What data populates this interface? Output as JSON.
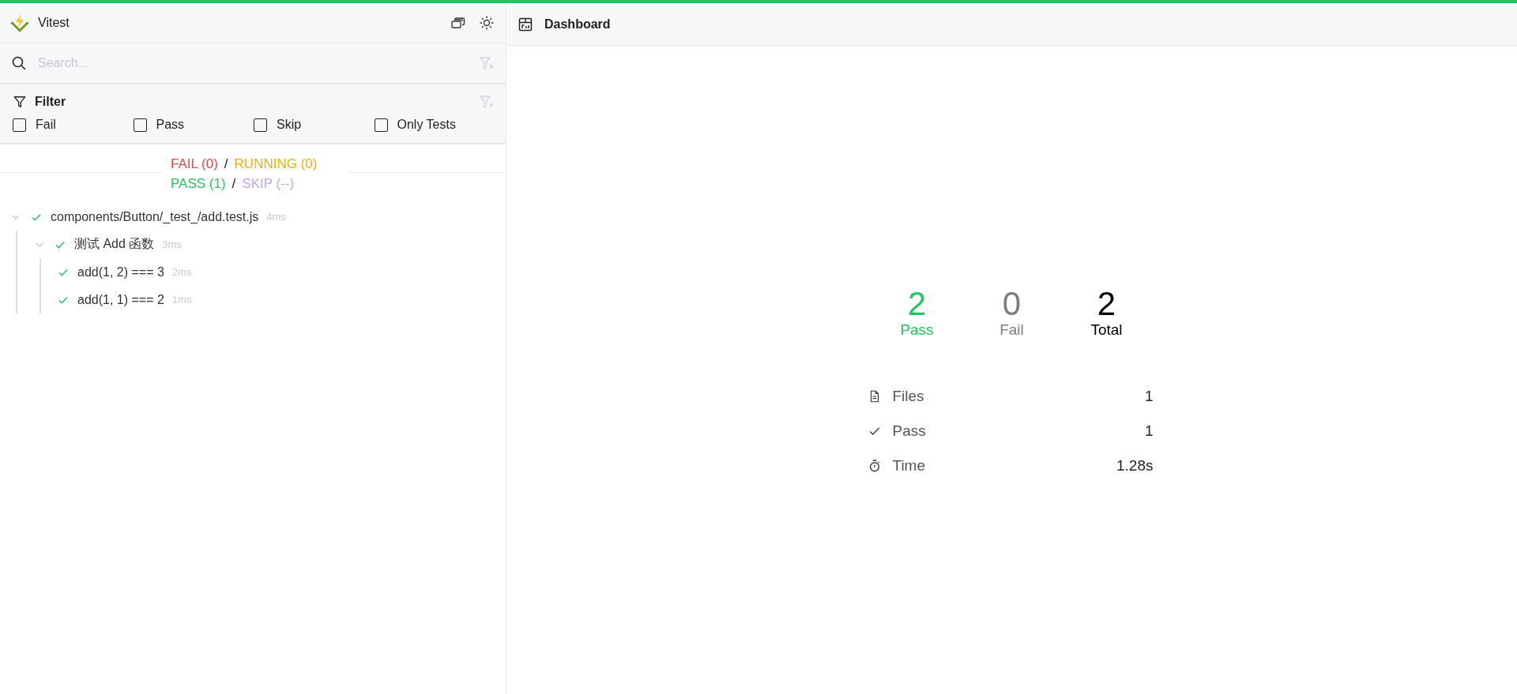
{
  "app": {
    "title": "Vitest"
  },
  "search": {
    "placeholder": "Search..."
  },
  "filter": {
    "title": "Filter",
    "options": [
      {
        "label": "Fail",
        "checked": false
      },
      {
        "label": "Pass",
        "checked": false
      },
      {
        "label": "Skip",
        "checked": false
      },
      {
        "label": "Only Tests",
        "checked": false
      }
    ]
  },
  "summary": [
    {
      "left": {
        "text": "FAIL (0)",
        "kind": "fail"
      },
      "separator": "/",
      "right": {
        "text": "RUNNING (0)",
        "kind": "running"
      }
    },
    {
      "left": {
        "text": "PASS (1)",
        "kind": "pass"
      },
      "separator": "/",
      "right": {
        "text": "SKIP (--)",
        "kind": "skip"
      }
    }
  ],
  "tree": [
    {
      "name": "components/Button/_test_/add.test.js",
      "duration": "4ms",
      "passed": true,
      "expanded": true,
      "children": [
        {
          "name": "测试 Add 函数",
          "duration": "3ms",
          "passed": true,
          "expanded": true,
          "children": [
            {
              "name": "add(1, 2) === 3",
              "duration": "2ms",
              "passed": true
            },
            {
              "name": "add(1, 1) === 2",
              "duration": "1ms",
              "passed": true
            }
          ]
        }
      ]
    }
  ],
  "main": {
    "title": "Dashboard"
  },
  "counts": [
    {
      "value": "2",
      "label": "Pass",
      "kind": "pass"
    },
    {
      "value": "0",
      "label": "Fail",
      "kind": "fail"
    },
    {
      "value": "2",
      "label": "Total",
      "kind": "total"
    }
  ],
  "stats": [
    {
      "kind": "files",
      "label": "Files",
      "value": "1"
    },
    {
      "kind": "pass",
      "label": "Pass",
      "value": "1"
    },
    {
      "kind": "time",
      "label": "Time",
      "value": "1.28s"
    }
  ]
}
